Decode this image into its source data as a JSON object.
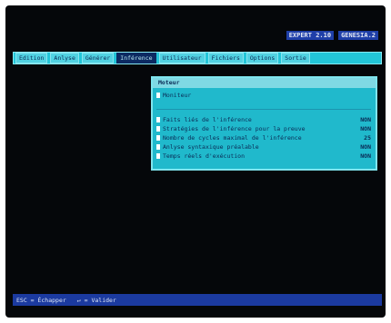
{
  "title": {
    "version": "EXPERT 2.10",
    "module": "GENESIA.2"
  },
  "menu": [
    "Edition",
    "Anlyse",
    "Générer",
    "Inférence",
    "Utilisateur",
    "Fichiers",
    "Options",
    "Sortie"
  ],
  "active_menu_index": 3,
  "dropdown": {
    "title": "Moteur",
    "first_item": "Moniteur",
    "items": [
      {
        "label": "Faits liés de l'inférence",
        "value": "NON"
      },
      {
        "label": "Stratégies de l'inférence pour la preuve",
        "value": "NON"
      },
      {
        "label": "Nombre de cycles maximal de l'inférence",
        "value": "25"
      },
      {
        "label": "Anlyse syntaxique préalable",
        "value": "NON"
      },
      {
        "label": "Temps réels d'exécution",
        "value": "NON"
      }
    ]
  },
  "status": {
    "escape": "ESC = Échapper",
    "enter": "↵ = Valider"
  }
}
